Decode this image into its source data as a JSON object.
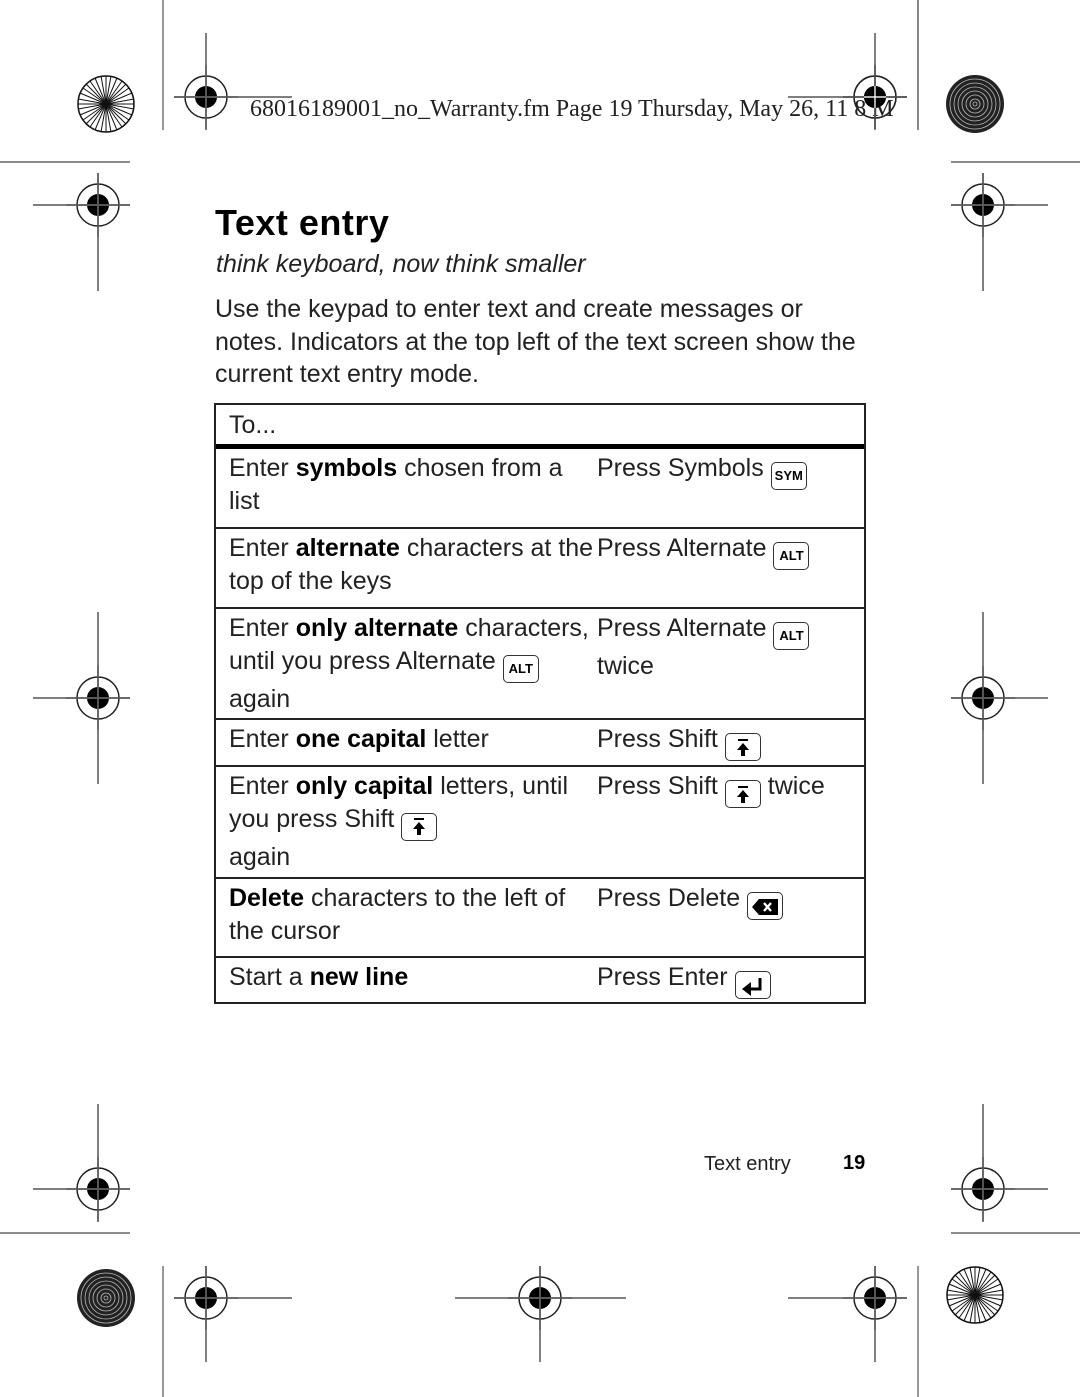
{
  "print_header": {
    "text": "68016189001_no_Warranty.fm  Page 19  Thursday, May 26, 2011  8:00 AM",
    "visible_text": "68016189001_no_Warranty.fm  Page 19  Thursday, May 26,   11  8     M"
  },
  "section": {
    "title": "Text entry",
    "subtitle": "think keyboard, now think smaller",
    "intro": "Use the keypad to enter text and create messages or notes. Indicators at the top left of the text screen show the current text entry mode."
  },
  "table": {
    "header": "To...",
    "rows": [
      {
        "a_pre": "Enter ",
        "a_bold": "symbols",
        "a_post": " chosen from a list",
        "b_pre": "Press Symbols ",
        "b_key": "SYM",
        "b_key_icon": "sym-key-icon",
        "b_post": ""
      },
      {
        "a_pre": "Enter ",
        "a_bold": "alternate",
        "a_post": " characters at the top of the keys",
        "b_pre": "Press Alternate ",
        "b_key": "ALT",
        "b_key_icon": "alt-key-icon",
        "b_post": ""
      },
      {
        "a_pre": "Enter ",
        "a_bold": "only alternate",
        "a_post": " characters, until you press Alternate ",
        "a_key": "ALT",
        "a_post2": " again",
        "b_pre": "Press Alternate ",
        "b_key": "ALT",
        "b_key_icon": "alt-key-icon",
        "b_post": " twice"
      },
      {
        "a_pre": "Enter ",
        "a_bold": "one capital",
        "a_post": " letter",
        "b_pre": "Press Shift ",
        "b_key_icon": "shift-key-icon",
        "b_post": ""
      },
      {
        "a_pre": "Enter ",
        "a_bold": "only capital",
        "a_post": " letters, until you press Shift ",
        "a_key_icon": "shift-key-icon",
        "a_post2": " again",
        "b_pre": "Press Shift ",
        "b_key_icon": "shift-key-icon",
        "b_post": " twice"
      },
      {
        "a_pre": "",
        "a_bold": "Delete",
        "a_post": " characters to the left of the cursor",
        "b_pre": "Press Delete ",
        "b_key_icon": "delete-key-icon",
        "b_post": ""
      },
      {
        "a_pre": "Start a ",
        "a_bold": "new line",
        "a_post": "",
        "b_pre": "Press Enter ",
        "b_key_icon": "enter-key-icon",
        "b_post": ""
      }
    ]
  },
  "footer": {
    "label": "Text entry",
    "page": "19"
  }
}
